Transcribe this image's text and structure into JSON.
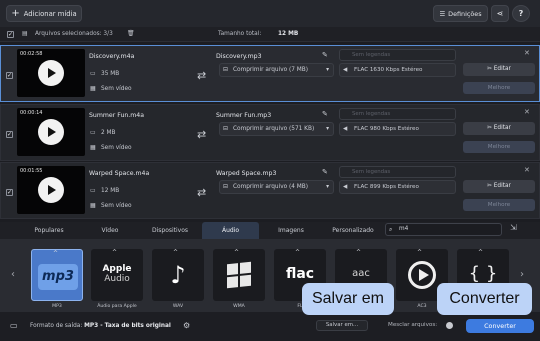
{
  "toolbar": {
    "add_media": "Adicionar mídia",
    "settings": "Definições",
    "share_icon": "share-icon",
    "help": "?"
  },
  "selection": {
    "files_selected": "Arquivos selecionados: 3/3",
    "total_size_label": "Tamanho total:",
    "total_size_value": "12 MB"
  },
  "files": [
    {
      "duration": "00:02:58",
      "source_name": "Discovery.m4a",
      "source_size": "35 MB",
      "video": "Sem vídeo",
      "output_name": "Discovery.mp3",
      "compress": "Comprimir arquivo (7 MB)",
      "subtitles": "Sem legendas",
      "audio": "FLAC 1630 Kbps Estéreo",
      "edit": "Editar",
      "improve": "Melhore"
    },
    {
      "duration": "00:00:14",
      "source_name": "Summer Fun.m4a",
      "source_size": "2 MB",
      "video": "Sem vídeo",
      "output_name": "Summer Fun.mp3",
      "compress": "Comprimir arquivo (571 KB)",
      "subtitles": "Sem legendas",
      "audio": "FLAC 980 Kbps Estéreo",
      "edit": "Editar",
      "improve": "Melhore"
    },
    {
      "duration": "00:01:55",
      "source_name": "Warped Space.m4a",
      "source_size": "12 MB",
      "video": "Sem vídeo",
      "output_name": "Warped Space.mp3",
      "compress": "Comprimir arquivo (4 MB)",
      "subtitles": "Sem legendas",
      "audio": "FLAC 899 Kbps Estéreo",
      "edit": "Editar",
      "improve": "Melhore"
    }
  ],
  "tabs": [
    "Populares",
    "Vídeo",
    "Dispositivos",
    "Áudio",
    "Imagens",
    "Personalizado"
  ],
  "active_tab": "Áudio",
  "search": {
    "value": "m4"
  },
  "formats": [
    {
      "label": "MP3",
      "icon": "mp3"
    },
    {
      "label": "Áudio para Apple",
      "icon": "Apple Audio"
    },
    {
      "label": "WAV",
      "icon": "music-note-icon"
    },
    {
      "label": "WMA",
      "icon": "windows-icon"
    },
    {
      "label": "FL",
      "icon": "flac"
    },
    {
      "label": "",
      "icon": "aac"
    },
    {
      "label": "AC3",
      "icon": "play-circle-icon"
    },
    {
      "label": "",
      "icon": "braces-icon"
    }
  ],
  "bottom": {
    "output_format_label": "Formato de saída:",
    "output_format_value": "MP3 - Taxa de bits original",
    "save_in": "Salvar em...",
    "merge": "Mesclar arquivos:",
    "convert": "Converter"
  },
  "callouts": {
    "save": "Salvar em",
    "convert": "Converter"
  },
  "colors": {
    "accent": "#3d7be0",
    "callout": "#bcd3f7"
  }
}
